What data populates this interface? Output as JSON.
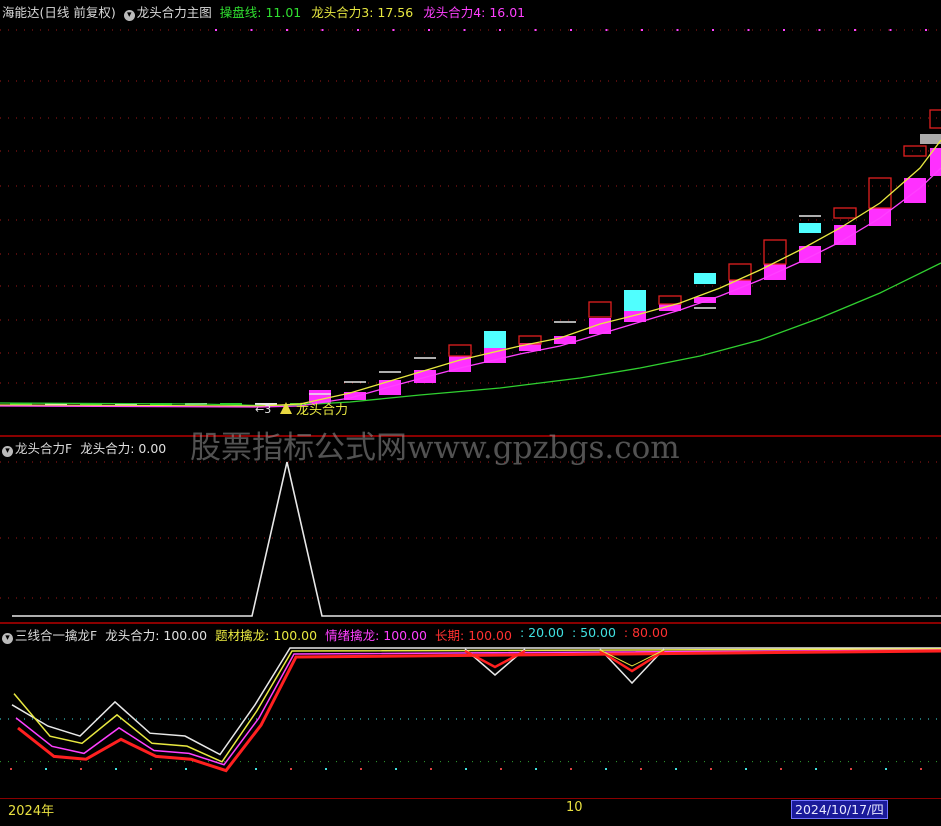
{
  "panel1": {
    "stock_name": "海能达",
    "period": "(日线 前复权)",
    "indicator": "龙头合力主图",
    "items": [
      {
        "label": "操盘线: 11.01",
        "color": "#30e030"
      },
      {
        "label": "龙头合力3: 17.56",
        "color": "#e8e840"
      },
      {
        "label": "龙头合力4: 16.01",
        "color": "#ff40ff"
      }
    ],
    "signal_label": "龙头合力",
    "signal_prefix": "←3"
  },
  "panel2": {
    "indicator": "龙头合力F",
    "items": [
      {
        "label": "龙头合力: 0.00",
        "color": "#e0e0e0"
      }
    ]
  },
  "panel3": {
    "indicator": "三线合一擒龙F",
    "items": [
      {
        "label": "龙头合力: 100.00",
        "color": "#e0e0e0"
      },
      {
        "label": "题材擒龙: 100.00",
        "color": "#e8e840"
      },
      {
        "label": "情绪擒龙: 100.00",
        "color": "#ff40ff"
      },
      {
        "label": "长期: 100.00",
        "color": "#ff3030"
      },
      {
        "label": ": 20.00",
        "color": "#40e0e0"
      },
      {
        "label": ": 50.00",
        "color": "#40e0e0"
      },
      {
        "label": ": 80.00",
        "color": "#ff3030"
      }
    ]
  },
  "watermark": "股票指标公式网www.gpzbgs.com",
  "x_axis": {
    "start_label": "2024年",
    "mid_label": "10",
    "cursor_date": "2024/10/17/四"
  },
  "colors": {
    "up": "#e02020",
    "down_cyan": "#50ffff",
    "magenta": "#ff30ff",
    "green_line": "#30d030",
    "yellow_line": "#e8e840"
  },
  "chart_data": [
    {
      "type": "candlestick",
      "title": "龙头合力主图",
      "series": [
        {
          "name": "操盘线",
          "values": [
            11.01
          ]
        },
        {
          "name": "龙头合力3",
          "values": [
            17.56
          ]
        },
        {
          "name": "龙头合力4",
          "values": [
            16.01
          ]
        }
      ]
    },
    {
      "type": "line",
      "title": "龙头合力F",
      "series": [
        {
          "name": "龙头合力",
          "values": [
            0,
            0,
            0,
            0,
            0,
            0,
            0,
            0,
            100,
            0,
            0,
            0,
            0,
            0,
            0,
            0,
            0,
            0,
            0,
            0,
            0,
            0,
            0,
            0,
            0,
            0,
            0
          ]
        }
      ]
    },
    {
      "type": "line",
      "title": "三线合一擒龙F",
      "ylim": [
        0,
        100
      ],
      "series": [
        {
          "name": "龙头合力",
          "values": [
            60,
            45,
            38,
            62,
            40,
            38,
            25,
            60,
            100,
            100,
            100,
            100,
            100,
            100,
            100,
            100,
            100,
            100,
            100,
            100,
            100,
            100,
            100,
            100,
            100,
            100,
            100
          ]
        },
        {
          "name": "题材擒龙",
          "values": [
            70,
            40,
            35,
            55,
            35,
            33,
            22,
            58,
            100,
            100,
            100,
            100,
            100,
            100,
            100,
            100,
            100,
            100,
            100,
            100,
            100,
            100,
            100,
            100,
            100,
            100,
            100
          ]
        },
        {
          "name": "情绪擒龙",
          "values": [
            55,
            35,
            30,
            48,
            32,
            30,
            22,
            55,
            100,
            100,
            100,
            100,
            100,
            100,
            100,
            100,
            100,
            100,
            100,
            100,
            100,
            100,
            100,
            100,
            100,
            100,
            100
          ]
        },
        {
          "name": "长期",
          "values": [
            50,
            30,
            28,
            42,
            30,
            28,
            20,
            52,
            100,
            100,
            100,
            100,
            100,
            100,
            100,
            100,
            100,
            100,
            100,
            100,
            100,
            100,
            100,
            100,
            100,
            100,
            100
          ]
        }
      ],
      "reference_lines": [
        20,
        50,
        80
      ]
    }
  ]
}
